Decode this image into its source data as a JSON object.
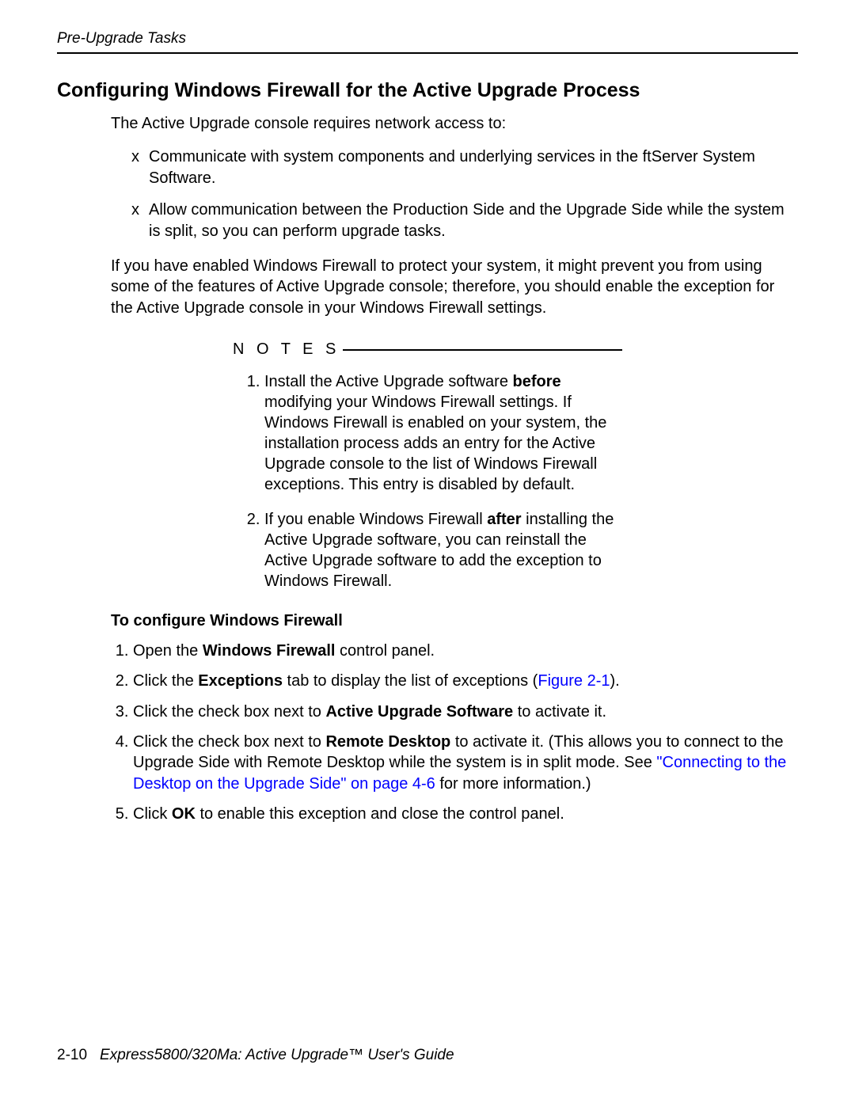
{
  "header": {
    "running_head": "Pre-Upgrade Tasks"
  },
  "section": {
    "title": "Configuring Windows Firewall for the Active Upgrade Process",
    "intro": "The Active Upgrade console requires network access to:",
    "bullets": [
      "Communicate with system components and underlying services in the ftServer System Software.",
      "Allow communication between the Production Side and the Upgrade Side while the system is split, so you can perform upgrade tasks."
    ],
    "firewall_para": "If you have enabled Windows Firewall to protect your system, it might prevent you from using some of the features of Active Upgrade console; therefore, you should enable the exception for the Active Upgrade console in your Windows Firewall settings."
  },
  "notes": {
    "label": "N O T E S",
    "items": {
      "n1_before": "Install the Active Upgrade software ",
      "n1_bold": "before",
      "n1_after": " modifying your Windows Firewall settings. If Windows Firewall is enabled on your system, the installation process adds an entry for the Active Upgrade console to the list of Windows Firewall exceptions. This entry is disabled by default.",
      "n2_before": "If you enable Windows Firewall ",
      "n2_bold": "after",
      "n2_after": " installing the Active Upgrade software, you can reinstall the Active Upgrade software to add the exception to Windows Firewall."
    }
  },
  "procedure": {
    "heading": "To configure Windows Firewall",
    "s1_a": "Open the ",
    "s1_b": "Windows Firewall",
    "s1_c": " control panel.",
    "s2_a": "Click the ",
    "s2_b": "Exceptions",
    "s2_c": " tab to display the list of exceptions (",
    "s2_link": "Figure 2-1",
    "s2_d": ").",
    "s3_a": "Click the check box next to ",
    "s3_b": "Active Upgrade Software",
    "s3_c": " to activate it.",
    "s4_a": "Click the check box next to ",
    "s4_b": "Remote Desktop",
    "s4_c": " to activate it. (This allows you to connect to the Upgrade Side with Remote Desktop while the system is in split mode. See ",
    "s4_link": "\"Connecting to the Desktop on the Upgrade Side\" on page 4-6",
    "s4_d": " for more information.)",
    "s5_a": "Click ",
    "s5_b": "OK",
    "s5_c": " to enable this exception and close the control panel."
  },
  "footer": {
    "page_number": "2-10",
    "doc_title": "Express5800/320Ma: Active Upgrade™ User's Guide"
  }
}
